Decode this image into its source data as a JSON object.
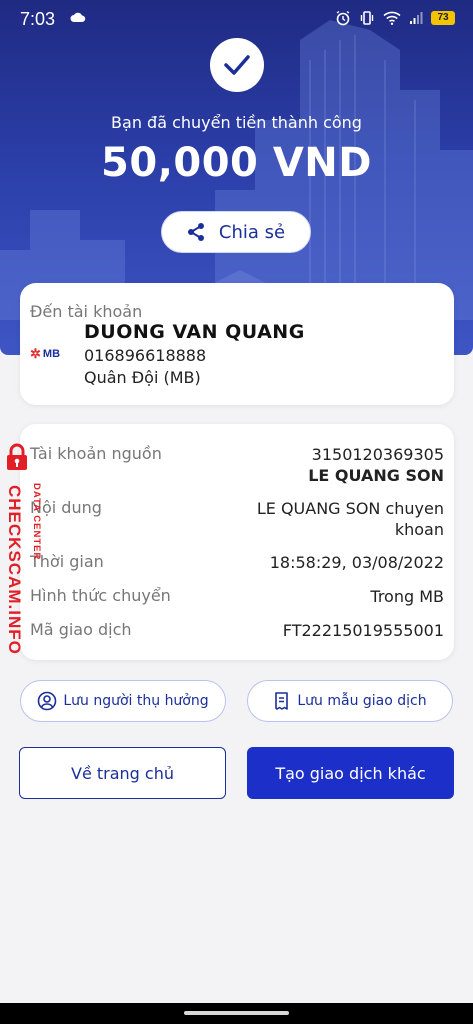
{
  "status_bar": {
    "time": "7:03",
    "battery": "73"
  },
  "hero": {
    "subtitle": "Bạn đã chuyển tiền thành công",
    "amount": "50,000 VND",
    "share_label": "Chia sẻ"
  },
  "recipient": {
    "section_label": "Đến tài khoản",
    "bank_logo_text": "MB",
    "name": "DUONG VAN QUANG",
    "account_number": "016896618888",
    "bank_name": "Quân Đội (MB)"
  },
  "details": {
    "source_label": "Tài khoản nguồn",
    "source_account": "3150120369305",
    "source_name": "LE QUANG SON",
    "content_label": "Nội dung",
    "content_value_line1": "LE QUANG SON chuyen",
    "content_value_line2": "khoan",
    "time_label": "Thời gian",
    "time_value": "18:58:29, 03/08/2022",
    "method_label": "Hình thức chuyển",
    "method_value": "Trong MB",
    "txn_label": "Mã giao dịch",
    "txn_value": "FT22215019555001"
  },
  "actions": {
    "save_recipient": "Lưu người thụ hưởng",
    "save_template": "Lưu mẫu giao dịch",
    "home": "Về trang chủ",
    "new_transaction": "Tạo giao dịch khác"
  },
  "watermark": {
    "main": "CHECKSCAM.INFO",
    "sub": "DATA CENTER"
  },
  "colors": {
    "primary": "#1c2fc9",
    "hero": "#2b3ea8",
    "watermark": "#e21f26"
  }
}
